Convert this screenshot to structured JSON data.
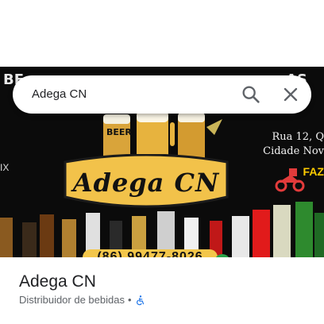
{
  "search": {
    "query": "Adega CN"
  },
  "hero": {
    "badge_text": "Adega CN",
    "address_line1": "Rua 12, Q",
    "address_line2": "Cidade Nov",
    "delivery_text": "FAZ",
    "phone": "(86) 99477-8026",
    "beer_sign": "BEER",
    "left_mark": "IX"
  },
  "place": {
    "name": "Adega CN",
    "category": "Distribuidor de bebidas",
    "separator": "•",
    "accessibility_icon": "wheelchair-accessible-icon"
  },
  "colors": {
    "badge": "#f2c24a",
    "hero_bg": "#0b0b0b",
    "access": "#1a73e8"
  }
}
